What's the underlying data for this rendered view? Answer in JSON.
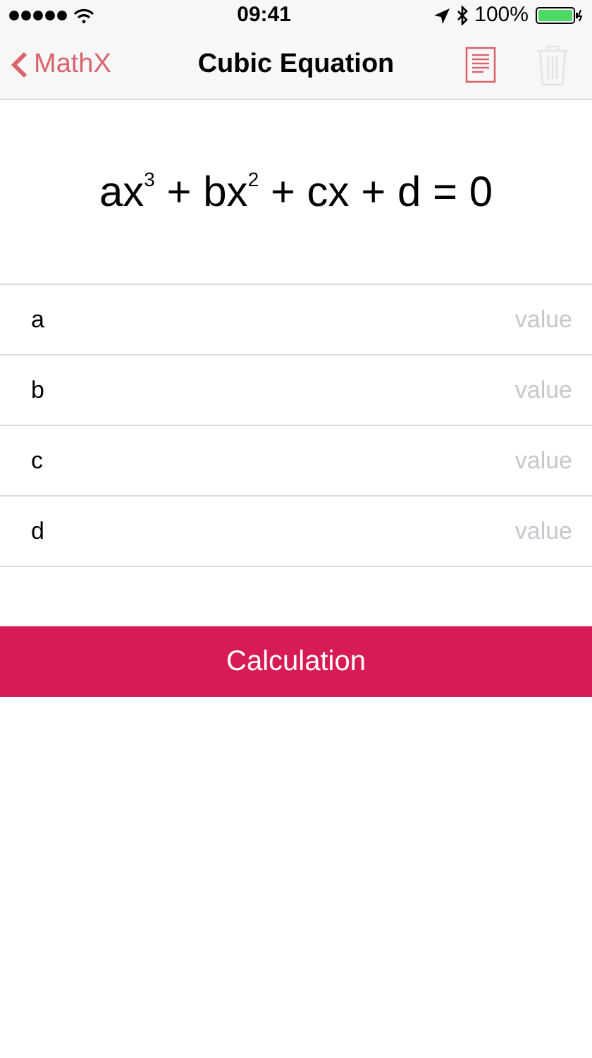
{
  "status_bar": {
    "time": "09:41",
    "battery": "100%"
  },
  "nav": {
    "back": "MathX",
    "title": "Cubic Equation",
    "actions": [
      {
        "kind": "notes",
        "disabled": false
      },
      {
        "kind": "trash",
        "disabled": true
      }
    ]
  },
  "equation": "ax$^{3}$ + bx$^{2}$ + cx + d = 0",
  "fields": [
    {
      "label": "a",
      "placeholder": "value"
    },
    {
      "label": "b",
      "placeholder": "value"
    },
    {
      "label": "c",
      "placeholder": "value"
    },
    {
      "label": "d",
      "placeholder": "value"
    }
  ],
  "button": "Calculation"
}
